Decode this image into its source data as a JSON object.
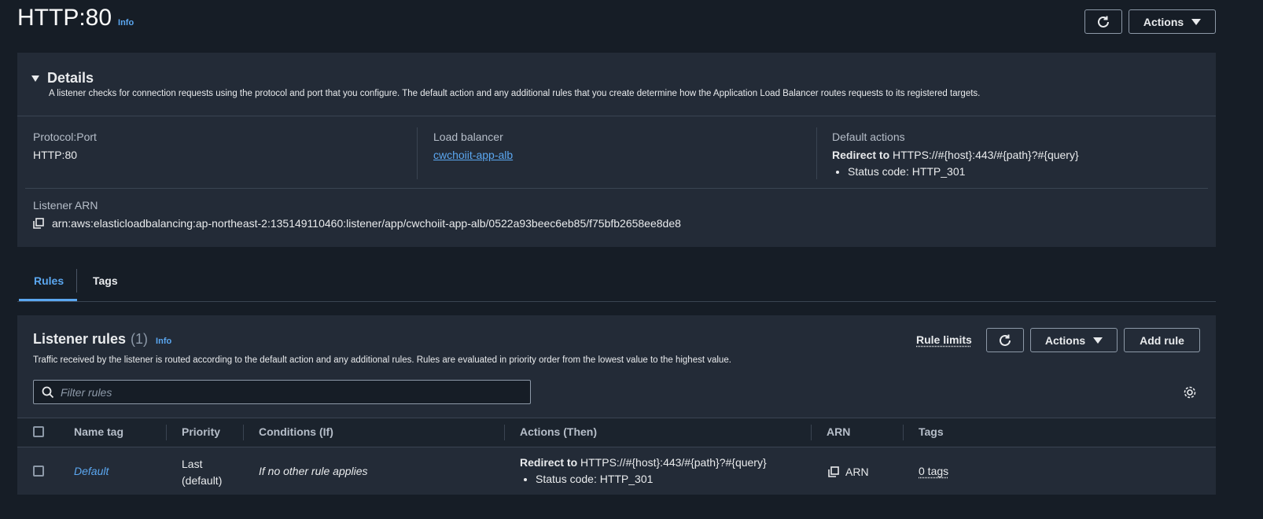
{
  "header": {
    "title": "HTTP:80",
    "info": "Info",
    "actions_label": "Actions"
  },
  "details": {
    "title": "Details",
    "description": "A listener checks for connection requests using the protocol and port that you configure. The default action and any additional rules that you create determine how the Application Load Balancer routes requests to its registered targets.",
    "protocol_label": "Protocol:Port",
    "protocol_value": "HTTP:80",
    "lb_label": "Load balancer",
    "lb_value": "cwchoiit-app-alb",
    "default_actions_label": "Default actions",
    "redirect_prefix": "Redirect to",
    "redirect_target": "HTTPS://#{host}:443/#{path}?#{query}",
    "status_code": "Status code: HTTP_301",
    "arn_label": "Listener ARN",
    "arn_value": "arn:aws:elasticloadbalancing:ap-northeast-2:135149110460:listener/app/cwchoiit-app-alb/0522a93beec6eb85/f75bfb2658ee8de8"
  },
  "tabs": [
    {
      "label": "Rules"
    },
    {
      "label": "Tags"
    }
  ],
  "rules": {
    "title": "Listener rules",
    "count": "(1)",
    "info": "Info",
    "description": "Traffic received by the listener is routed according to the default action and any additional rules. Rules are evaluated in priority order from the lowest value to the highest value.",
    "rule_limits": "Rule limits",
    "actions_label": "Actions",
    "add_rule": "Add rule",
    "filter_placeholder": "Filter rules",
    "columns": [
      "Name tag",
      "Priority",
      "Conditions (If)",
      "Actions (Then)",
      "ARN",
      "Tags"
    ],
    "rows": [
      {
        "name": "Default",
        "priority_line1": "Last",
        "priority_line2": "(default)",
        "condition": "If no other rule applies",
        "action_prefix": "Redirect to",
        "action_target": "HTTPS://#{host}:443/#{path}?#{query}",
        "action_status": "Status code: HTTP_301",
        "arn": "ARN",
        "tags": "0 tags"
      }
    ]
  }
}
